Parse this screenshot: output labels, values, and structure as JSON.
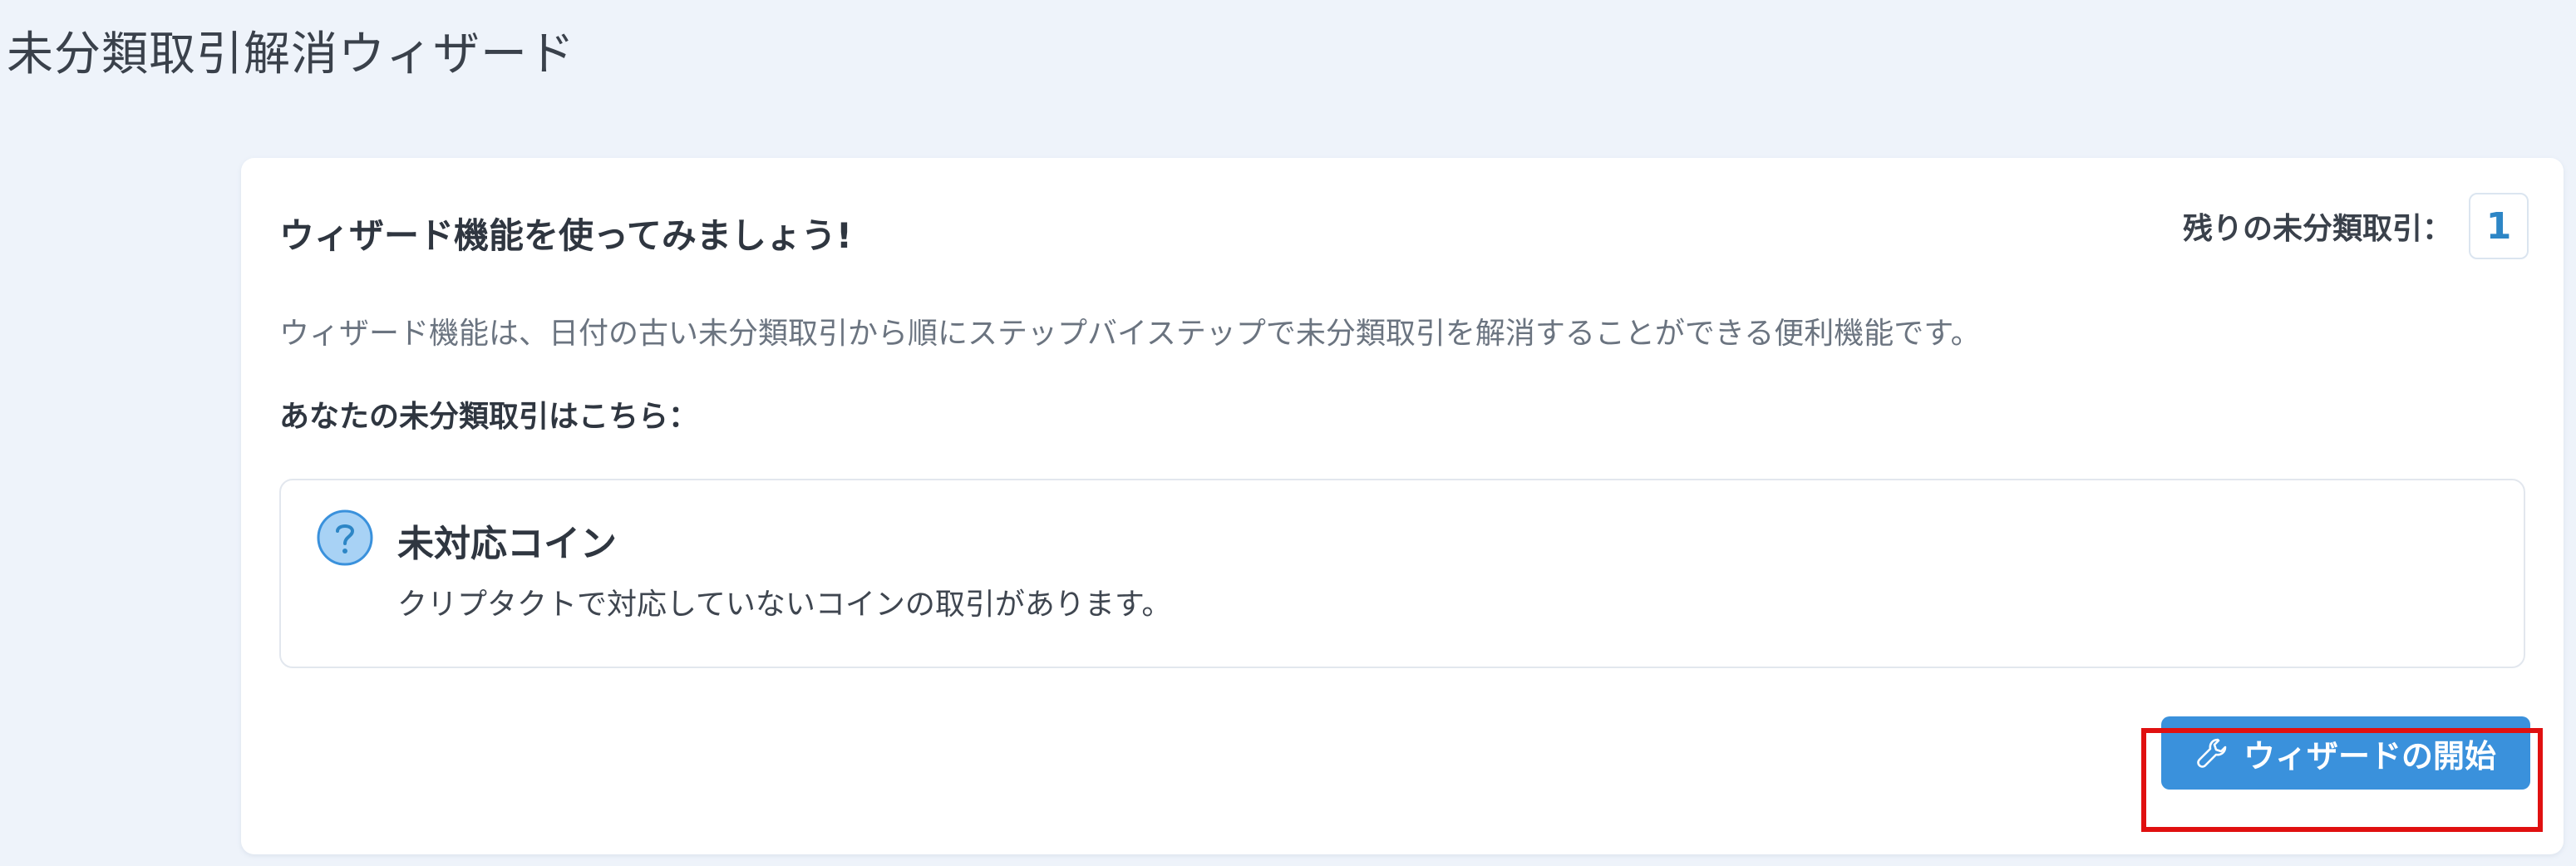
{
  "page": {
    "title": "未分類取引解消ウィザード"
  },
  "card": {
    "header": "ウィザード機能を使ってみましょう!",
    "remaining_label": "残りの未分類取引：",
    "remaining_count": "1",
    "description": "ウィザード機能は、日付の古い未分類取引から順にステップバイステップで未分類取引を解消することができる便利機能です。",
    "section_label": "あなたの未分類取引はこちら："
  },
  "issue": {
    "icon": "question-circle-icon",
    "title": "未対応コイン",
    "description": "クリプタクトで対応していないコインの取引があります。"
  },
  "actions": {
    "start_icon": "wrench-icon",
    "start_label": "ウィザードの開始"
  },
  "colors": {
    "background": "#eef3fa",
    "accent": "#3a91dc",
    "count_text": "#2d86c6",
    "highlight_frame": "#e01010"
  }
}
